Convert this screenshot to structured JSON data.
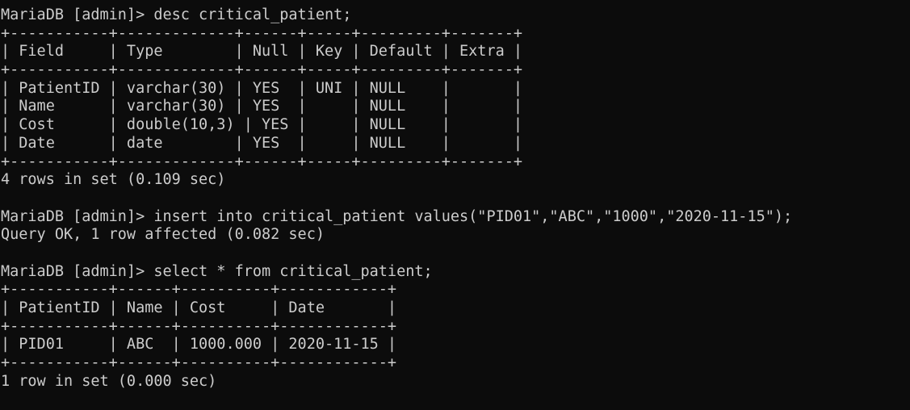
{
  "terminal": {
    "background": "#0c0c0c",
    "foreground": "#cccccc",
    "lines": [
      "MariaDB [admin]> desc critical_patient;",
      "+-----------+-------------+------+-----+---------+-------+",
      "| Field     | Type        | Null | Key | Default | Extra |",
      "+-----------+-------------+------+-----+---------+-------+",
      "| PatientID | varchar(30) | YES  | UNI | NULL    |       |",
      "| Name      | varchar(30) | YES  |     | NULL    |       |",
      "| Cost      | double(10,3) | YES |     | NULL    |       |",
      "| Date      | date        | YES  |     | NULL    |       |",
      "+-----------+-------------+------+-----+---------+-------+",
      "4 rows in set (0.109 sec)",
      "",
      "MariaDB [admin]> insert into critical_patient values(\"PID01\",\"ABC\",\"1000\",\"2020-11-15\");",
      "Query OK, 1 row affected (0.082 sec)",
      "",
      "MariaDB [admin]> select * from critical_patient;",
      "+-----------+------+----------+------------+",
      "| PatientID | Name | Cost     | Date       |",
      "+-----------+------+----------+------------+",
      "| PID01     | ABC  | 1000.000 | 2020-11-15 |",
      "+-----------+------+----------+------------+",
      "1 row in set (0.000 sec)"
    ]
  }
}
